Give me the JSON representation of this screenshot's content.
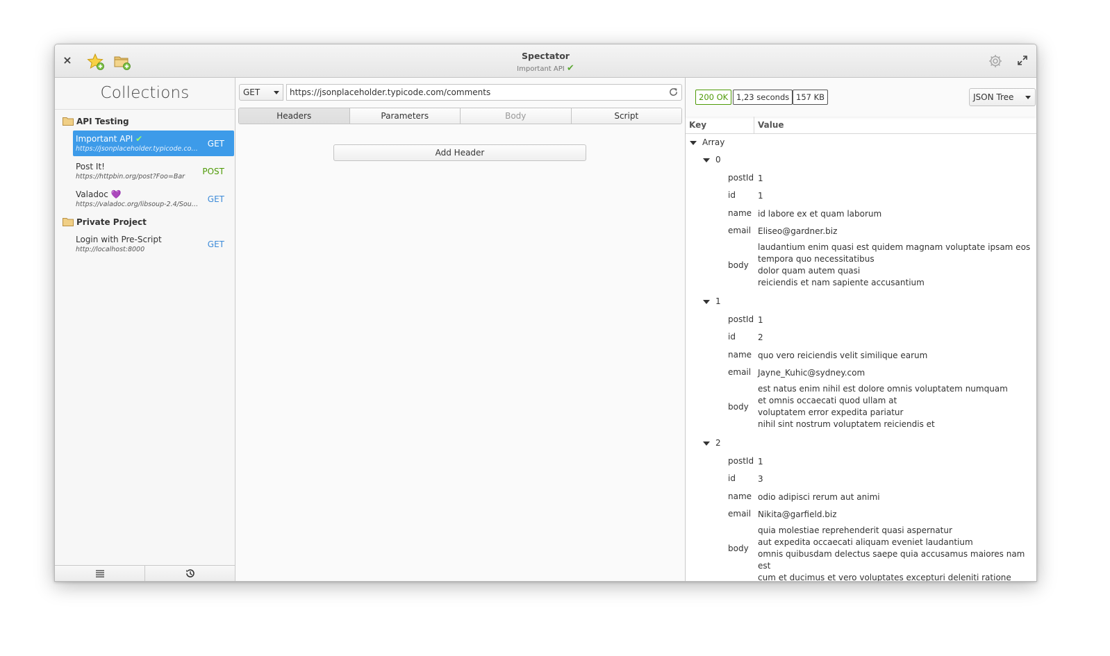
{
  "window": {
    "title": "Spectator",
    "subtitle": "Important API",
    "subtitle_check": "✔"
  },
  "sidebar": {
    "title": "Collections",
    "folders": [
      {
        "name": "API Testing",
        "requests": [
          {
            "name": "Important API",
            "badge": "✔",
            "url": "https://jsonplaceholder.typicode.com/comments",
            "method": "GET",
            "selected": true
          },
          {
            "name": "Post It!",
            "badge": "",
            "url": "https://httpbin.org/post?Foo=Bar",
            "method": "POST",
            "selected": false
          },
          {
            "name": "Valadoc",
            "badge": "💜",
            "url": "https://valadoc.org/libsoup-2.4/Soup....",
            "method": "GET",
            "selected": false
          }
        ]
      },
      {
        "name": "Private Project",
        "requests": [
          {
            "name": "Login with Pre-Script",
            "badge": "",
            "url": "http://localhost:8000",
            "method": "GET",
            "selected": false
          }
        ]
      }
    ]
  },
  "request": {
    "method": "GET",
    "url": "https://jsonplaceholder.typicode.com/comments",
    "tabs": [
      "Headers",
      "Parameters",
      "Body",
      "Script"
    ],
    "active_tab": "Headers",
    "add_header_label": "Add Header"
  },
  "response": {
    "status": "200 OK",
    "time": "1,23 seconds",
    "size": "157 KB",
    "view_mode": "JSON Tree",
    "columns": {
      "key": "Key",
      "value": "Value"
    },
    "root": "Array",
    "items": [
      {
        "index": "0",
        "fields": [
          {
            "key": "postId",
            "value": "1"
          },
          {
            "key": "id",
            "value": "1"
          },
          {
            "key": "name",
            "value": "id labore ex et quam laborum"
          },
          {
            "key": "email",
            "value": "Eliseo@gardner.biz"
          },
          {
            "key": "body",
            "value": "laudantium enim quasi est quidem magnam voluptate ipsam eos\ntempora quo necessitatibus\ndolor quam autem quasi\nreiciendis et nam sapiente accusantium"
          }
        ]
      },
      {
        "index": "1",
        "fields": [
          {
            "key": "postId",
            "value": "1"
          },
          {
            "key": "id",
            "value": "2"
          },
          {
            "key": "name",
            "value": "quo vero reiciendis velit similique earum"
          },
          {
            "key": "email",
            "value": "Jayne_Kuhic@sydney.com"
          },
          {
            "key": "body",
            "value": "est natus enim nihil est dolore omnis voluptatem numquam\net omnis occaecati quod ullam at\nvoluptatem error expedita pariatur\nnihil sint nostrum voluptatem reiciendis et"
          }
        ]
      },
      {
        "index": "2",
        "fields": [
          {
            "key": "postId",
            "value": "1"
          },
          {
            "key": "id",
            "value": "3"
          },
          {
            "key": "name",
            "value": "odio adipisci rerum aut animi"
          },
          {
            "key": "email",
            "value": "Nikita@garfield.biz"
          },
          {
            "key": "body",
            "value": "quia molestiae reprehenderit quasi aspernatur\naut expedita occaecati aliquam eveniet laudantium\nomnis quibusdam delectus saepe quia accusamus maiores nam est\ncum et ducimus et vero voluptates excepturi deleniti ratione"
          }
        ]
      }
    ]
  },
  "colors": {
    "accent": "#3d9be9",
    "ok": "#4e9a06",
    "get": "#3d8bd9",
    "post": "#4e9a06"
  }
}
